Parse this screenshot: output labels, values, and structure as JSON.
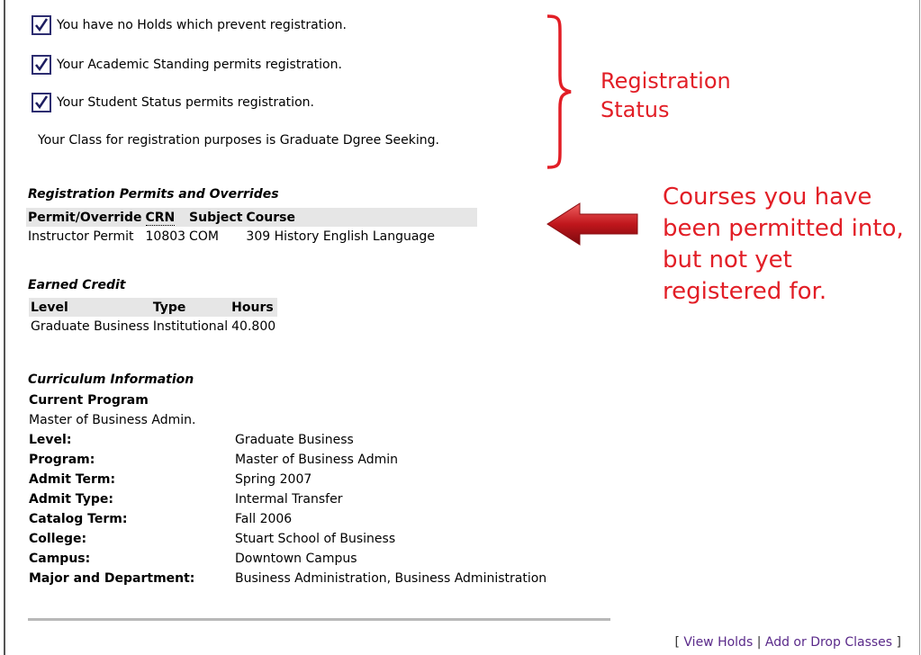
{
  "checks": [
    {
      "text": "You have no Holds which prevent registration."
    },
    {
      "text": "Your Academic Standing permits registration."
    },
    {
      "text": "Your Student Status permits registration."
    }
  ],
  "class_statement": "Your Class for registration purposes is Graduate Dgree Seeking.",
  "permits": {
    "title": "Registration Permits and Overrides",
    "headers": [
      "Permit/Override",
      "CRN",
      "Subject",
      "Course"
    ],
    "rows": [
      [
        "Instructor Permit",
        "10803",
        "COM",
        "309 History English Language"
      ]
    ]
  },
  "earned": {
    "title": "Earned Credit",
    "headers": [
      "Level",
      "Type",
      "Hours"
    ],
    "rows": [
      [
        "Graduate Business",
        "Institutional",
        "40.800"
      ]
    ]
  },
  "curriculum": {
    "title": "Curriculum Information",
    "current_program_label": "Current Program",
    "current_program_value": "Master of Business Admin.",
    "rows": [
      {
        "label": "Level:",
        "value": "Graduate Business"
      },
      {
        "label": "Program:",
        "value": "Master of Business Admin"
      },
      {
        "label": "Admit Term:",
        "value": "Spring 2007"
      },
      {
        "label": "Admit Type:",
        "value": "Intermal Transfer"
      },
      {
        "label": "Catalog Term:",
        "value": "Fall 2006"
      },
      {
        "label": "College:",
        "value": "Stuart School of Business"
      },
      {
        "label": "Campus:",
        "value": "Downtown Campus"
      },
      {
        "label": "Major and Department:",
        "value": "Business Administration, Business Administration"
      }
    ]
  },
  "footer": {
    "bracket_open": "[",
    "view_holds": "View Holds",
    "divider": "|",
    "add_drop": "Add or Drop Classes",
    "bracket_close": "]"
  },
  "annotations": {
    "registration_status": "Registration Status",
    "permitted_courses": "Courses you have been permitted into, but not yet registered for."
  },
  "colors": {
    "annotation": "#e21e26",
    "arrow": "#c0161c",
    "link": "#5a2a8a",
    "header_bg": "#e6e6e6"
  }
}
